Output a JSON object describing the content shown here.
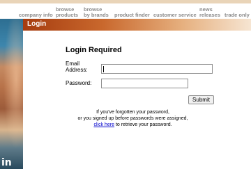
{
  "nav": {
    "company_info": "company info",
    "browse_products": [
      "browse",
      "products"
    ],
    "browse_brands": [
      "browse",
      "by brands"
    ],
    "product_finder": "product finder",
    "customer_service": "customer service",
    "news_releases": [
      "news",
      "releases"
    ],
    "trade_only": "trade only"
  },
  "header": {
    "title": "Login"
  },
  "photo": {
    "word": "in"
  },
  "form": {
    "heading": "Login Required",
    "email_label": [
      "Email",
      "Address:"
    ],
    "email_value": "",
    "password_label": "Password:",
    "password_value": "",
    "submit_label": "Submit"
  },
  "help": {
    "line1": "If you've forgotten your password,",
    "line2": "or you signed up before passwords were assigned,",
    "link": "click here",
    "line3_rest": " to retrieve your password."
  },
  "colors": {
    "accent": "#a63c0f",
    "link": "#0000cc",
    "nav_text": "#8a8a8a"
  }
}
